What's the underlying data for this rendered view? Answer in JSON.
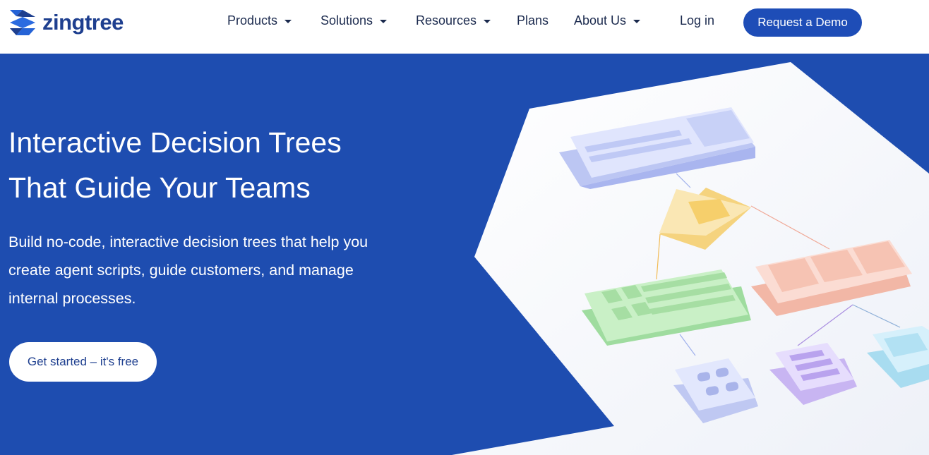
{
  "header": {
    "logo_text": "zingtree",
    "nav": [
      {
        "label": "Products",
        "has_caret": true
      },
      {
        "label": "Solutions",
        "has_caret": true
      },
      {
        "label": "Resources",
        "has_caret": true
      },
      {
        "label": "Plans",
        "has_caret": false
      },
      {
        "label": "About Us",
        "has_caret": true
      }
    ],
    "login_label": "Log in",
    "demo_label": "Request a Demo"
  },
  "hero": {
    "title_line1": "Interactive Decision Trees",
    "title_line2": "That Guide Your Teams",
    "subtitle_line1": "Build no-code, interactive decision trees that help you",
    "subtitle_line2": "create agent scripts, guide customers, and manage",
    "subtitle_line3": "internal processes.",
    "cta_label": "Get started – it's free"
  },
  "colors": {
    "brand_blue": "#1e4db0",
    "logo_blue": "#1e3f8f",
    "button_blue": "#1e4db7",
    "text_dark": "#1b2a4e"
  },
  "icons": [
    "zingtree-logo-mark",
    "caret-down-icon"
  ]
}
